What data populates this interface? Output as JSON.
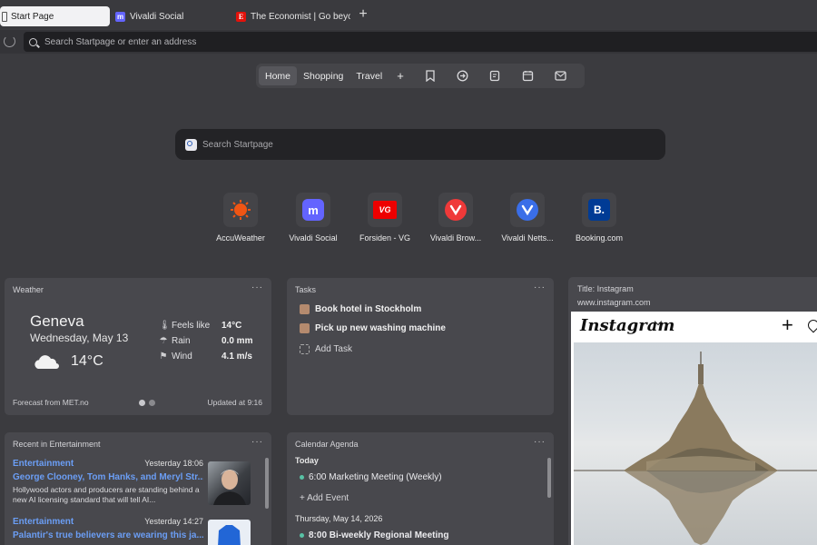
{
  "tabs": [
    {
      "label": "Start Page",
      "favicon": "start-page-icon",
      "active": true
    },
    {
      "label": "Vivaldi Social",
      "favicon": "mastodon-icon"
    },
    {
      "label": "The Economist | Go beyon",
      "favicon": "economist-icon",
      "favicon_text": "E"
    }
  ],
  "new_tab": "+",
  "address_bar": {
    "placeholder": "Search Startpage or enter an address"
  },
  "speed_dial_nav": {
    "items": [
      "Home",
      "Shopping",
      "Travel"
    ],
    "add": "+",
    "active": "Home"
  },
  "search": {
    "placeholder": "Search Startpage"
  },
  "speed_dials": [
    {
      "label": "AccuWeather",
      "icon": "accuweather-icon",
      "color": "#f05514"
    },
    {
      "label": "Vivaldi Social",
      "icon": "mastodon-icon",
      "color": "#6364ff"
    },
    {
      "label": "Forsiden - VG",
      "icon": "vg-icon",
      "color": "#e00",
      "icon_text": "VG"
    },
    {
      "label": "Vivaldi Brow...",
      "icon": "vivaldi-icon",
      "color": "#ef3939"
    },
    {
      "label": "Vivaldi Netts...",
      "icon": "vivaldi-icon",
      "color": "#3a6ee8"
    },
    {
      "label": "Booking.com",
      "icon": "booking-icon",
      "color": "#003b95",
      "icon_text": "B."
    }
  ],
  "weather": {
    "title": "Weather",
    "more": "···",
    "city": "Geneva",
    "date": "Wednesday, May 13",
    "temp": "14°C",
    "rows": [
      {
        "icon": "thermometer-icon",
        "key": "Feels like",
        "value": "14°C"
      },
      {
        "icon": "umbrella-icon",
        "key": "Rain",
        "value": "0.0 mm"
      },
      {
        "icon": "wind-flag-icon",
        "key": "Wind",
        "value": "4.1 m/s"
      }
    ],
    "source": "Forecast from MET.no",
    "updated": "Updated at 9:16"
  },
  "tasks": {
    "title": "Tasks",
    "more": "···",
    "items": [
      "Book hotel in Stockholm",
      "Pick up new washing machine"
    ],
    "add_label": "Add Task"
  },
  "instagram": {
    "title": "Title: Instagram",
    "url": "www.instagram.com",
    "logo": "Instagram"
  },
  "news": {
    "title": "Recent in Entertainment",
    "more": "···",
    "items": [
      {
        "category": "Entertainment",
        "time": "Yesterday 18:06",
        "headline": "George Clooney, Tom Hanks, and Meryl Str...",
        "desc": "Hollywood actors and producers are standing behind a new AI licensing standard that will tell AI..."
      },
      {
        "category": "Entertainment",
        "time": "Yesterday 14:27",
        "headline": "Palantir's true believers are wearing this ja...",
        "desc": ""
      }
    ]
  },
  "calendar": {
    "title": "Calendar Agenda",
    "more": "···",
    "today_label": "Today",
    "today_events": [
      {
        "time": "6:00",
        "title": "Marketing Meeting (Weekly)"
      }
    ],
    "add_event": "+ Add Event",
    "next_day": "Thursday,   May 14, 2026",
    "next_events": [
      {
        "time": "8:00",
        "title": "Bi-weekly Regional Meeting"
      }
    ]
  },
  "colors": {
    "accent_link": "#6b9ef5",
    "task_check": "#b48a6e",
    "event_dot": "#58c2a5"
  }
}
